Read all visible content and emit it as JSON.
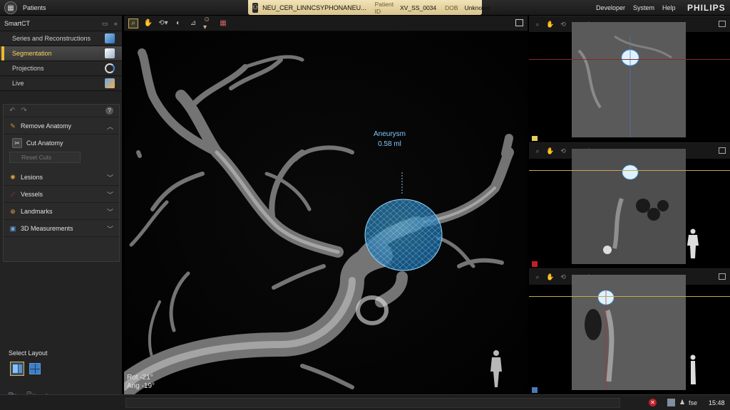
{
  "topbar": {
    "patients_label": "Patients",
    "patient_name": "NEU_CER_LINNCSYPHONANEU...",
    "patient_id_label": "Patient ID",
    "patient_id": "XV_SS_0034",
    "dob_label": "DOB",
    "dob": "Unknown",
    "menu": [
      "Developer",
      "System",
      "Help"
    ],
    "brand": "PHILIPS"
  },
  "left_panel": {
    "title": "SmartCT",
    "nav": [
      {
        "label": "Series and Reconstructions",
        "icon": "cube-icon"
      },
      {
        "label": "Segmentation",
        "icon": "segment-cube-icon",
        "active": true
      },
      {
        "label": "Projections",
        "icon": "rotate-arrows-icon"
      },
      {
        "label": "Live",
        "icon": "live-cube-icon"
      }
    ],
    "tools": {
      "remove_anatomy": "Remove Anatomy",
      "cut_anatomy": "Cut Anatomy",
      "reset_cuts": "Reset Cuts",
      "sections": [
        "Lesions",
        "Vessels",
        "Landmarks",
        "3D Measurements"
      ]
    },
    "select_layout": "Select Layout"
  },
  "main_view": {
    "annotation_title": "Aneurysm",
    "annotation_value": "0.58 ml",
    "rot": "Rot -21°",
    "ang": "Ang -19°"
  },
  "colors": {
    "accent": "#f0b82a",
    "annotation": "#7fc9ff",
    "slice_yellow": "#e2cf5a",
    "slice_red": "#c0202a",
    "slice_blue": "#4a7ab8"
  },
  "status": {
    "user": "fse",
    "time": "15:48"
  }
}
